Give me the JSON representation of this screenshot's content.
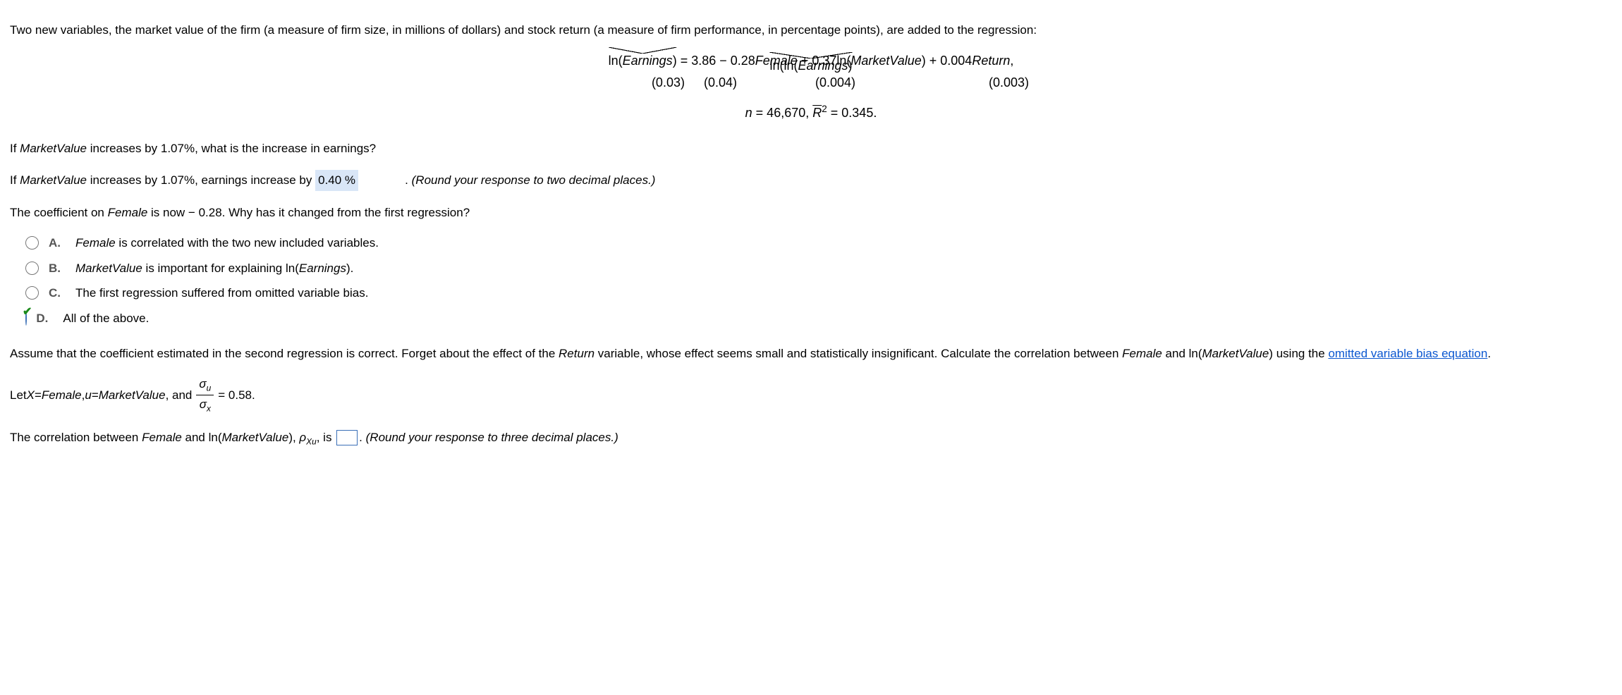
{
  "intro": "Two new variables, the market value of the firm (a measure of firm size, in millions of dollars) and stock return (a measure of firm performance, in percentage points), are added to the regression:",
  "equation": {
    "lhs_hat": "ln(Earnings)",
    "eq": " = 3.86 − 0.28",
    "t_female": "Female",
    "plus037": " + 0.37ln(",
    "t_mv": "MarketValue",
    "close037": ") + 0.004",
    "t_return": "Return",
    "comma": ",",
    "se1": "(0.03)",
    "se2": "(0.04)",
    "se3": "(0.004)",
    "se4": "(0.003)"
  },
  "stats": {
    "n_prefix": "n",
    "n_eq": " = 46,670, ",
    "rbar": "R",
    "rbar_sup": "2",
    "rbar_val": " = 0.345."
  },
  "q1": {
    "prompt_a": "If ",
    "prompt_mv": "MarketValue",
    "prompt_b": " increases by 1.07%, what is the increase in earnings?",
    "line2_a": "If ",
    "line2_b": " increases by 1.07%, earnings increase by ",
    "value": "0.40",
    "unit": " %",
    "post": ". ",
    "hint": "(Round your response to two decimal places.)"
  },
  "q2": {
    "text_a": "The coefficient on ",
    "text_female": "Female",
    "text_b": " is now − 0.28. Why has it changed from the first regression?"
  },
  "choices": {
    "A": {
      "label": "A.",
      "pre": "Female",
      "text": " is correlated with the two new included variables."
    },
    "B": {
      "label": "B.",
      "pre": "MarketValue",
      "text1": " is important for explaining ln(",
      "text_em": "Earnings",
      "text2": ")."
    },
    "C": {
      "label": "C.",
      "text": "The first regression suffered from omitted variable bias."
    },
    "D": {
      "label": "D.",
      "text": "All of the above.",
      "selected": true
    }
  },
  "assume": {
    "t1": "Assume that the coefficient estimated in the second regression is correct. Forget about the effect of the ",
    "return": "Return",
    "t2": " variable, whose effect seems small and statistically insignificant. Calculate the correlation between ",
    "female": "Female",
    "t3": " and ln(",
    "mv": "MarketValue",
    "t4": ") using the ",
    "link": "omitted variable bias equation",
    "t5": "."
  },
  "let": {
    "t1": "Let ",
    "x": "X",
    "eq1": " = ",
    "female": "Female",
    "comma": ", ",
    "u": "u",
    "eq2": " = ",
    "mv": "MarketValue",
    "and": ", and ",
    "frac_num": "σ",
    "frac_num_sub": "u",
    "frac_den": "σ",
    "frac_den_sub": "x",
    "val": " = 0.58."
  },
  "final": {
    "t1": "The correlation between ",
    "female": "Female",
    "t2": " and ln(",
    "mv": "MarketValue",
    "t3": "), ",
    "rho": "ρ",
    "rho_sub": "Xu",
    "t4": ", is ",
    "t5": ". ",
    "hint": "(Round your response to three decimal places.)"
  }
}
